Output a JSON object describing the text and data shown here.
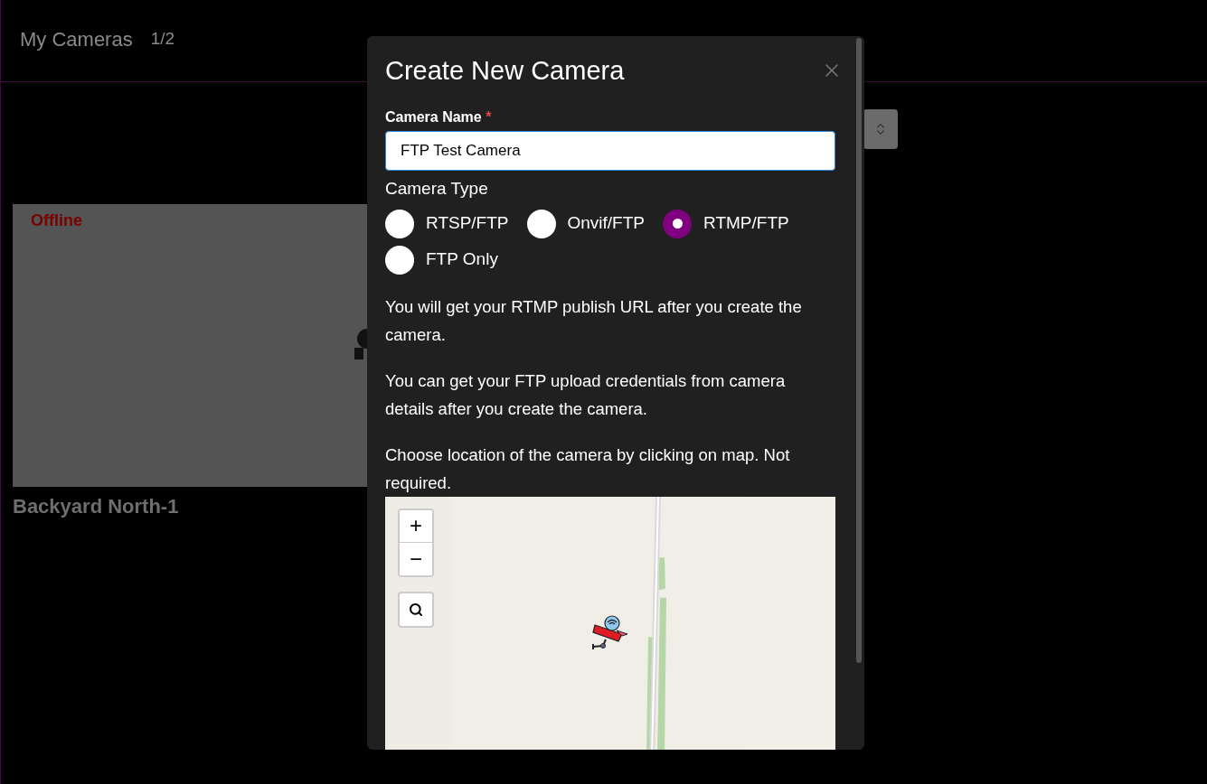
{
  "header": {
    "title": "My Cameras",
    "count": "1/2"
  },
  "cameras": [
    {
      "name": "Backyard North-1",
      "status": "Offline"
    }
  ],
  "dialog": {
    "title": "Create New Camera",
    "name_field": {
      "label": "Camera Name",
      "required_mark": "*",
      "value": "FTP Test Camera"
    },
    "camera_type": {
      "label": "Camera Type",
      "options": [
        {
          "label": "RTSP/FTP",
          "selected": false
        },
        {
          "label": "Onvif/FTP",
          "selected": false
        },
        {
          "label": "RTMP/FTP",
          "selected": true
        },
        {
          "label": "FTP Only",
          "selected": false
        }
      ]
    },
    "notes": [
      "You will get your RTMP publish URL after you create the camera.",
      "You can get your FTP upload credentials from camera details after you create the camera.",
      "Choose location of the camera by clicking on map. Not required."
    ],
    "map": {
      "zoom_in": "+",
      "zoom_out": "−"
    }
  }
}
